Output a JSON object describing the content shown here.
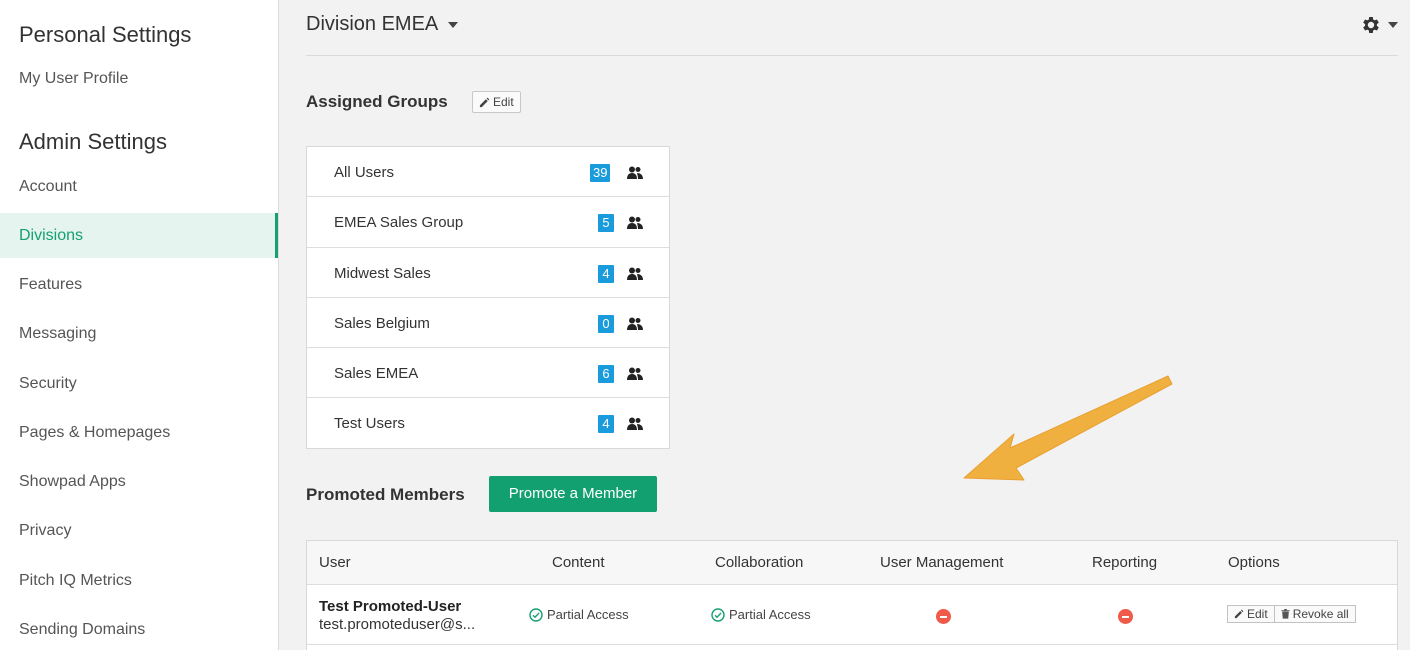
{
  "sidebar": {
    "personal_heading": "Personal Settings",
    "personal_items": [
      {
        "label": "My User Profile"
      }
    ],
    "admin_heading": "Admin Settings",
    "admin_items": [
      {
        "label": "Account"
      },
      {
        "label": "Divisions",
        "active": true
      },
      {
        "label": "Features"
      },
      {
        "label": "Messaging"
      },
      {
        "label": "Security"
      },
      {
        "label": "Pages & Homepages"
      },
      {
        "label": "Showpad Apps"
      },
      {
        "label": "Privacy"
      },
      {
        "label": "Pitch IQ Metrics"
      },
      {
        "label": "Sending Domains"
      }
    ]
  },
  "header": {
    "division": "Division EMEA",
    "settings_icon": "gear-icon"
  },
  "assigned_groups": {
    "title": "Assigned Groups",
    "edit_label": "Edit",
    "groups": [
      {
        "name": "All Users",
        "count": "39"
      },
      {
        "name": "EMEA Sales Group",
        "count": "5"
      },
      {
        "name": "Midwest Sales",
        "count": "4"
      },
      {
        "name": "Sales Belgium",
        "count": "0"
      },
      {
        "name": "Sales EMEA",
        "count": "6"
      },
      {
        "name": "Test Users",
        "count": "4"
      }
    ]
  },
  "promoted_members": {
    "title": "Promoted Members",
    "promote_button": "Promote a Member",
    "columns": [
      "User",
      "Content",
      "Collaboration",
      "User Management",
      "Reporting",
      "Options"
    ],
    "rows": [
      {
        "name": "Test Promoted-User",
        "email": "test.promoteduser@s...",
        "content": "Partial Access",
        "collaboration": "Partial Access",
        "user_management": "none",
        "reporting": "none",
        "edit_label": "Edit",
        "revoke_label": "Revoke all"
      }
    ]
  },
  "colors": {
    "accent": "#12a071",
    "badge": "#1a9bdc",
    "arrow": "#f0b040",
    "denied": "#ef5a4a"
  }
}
